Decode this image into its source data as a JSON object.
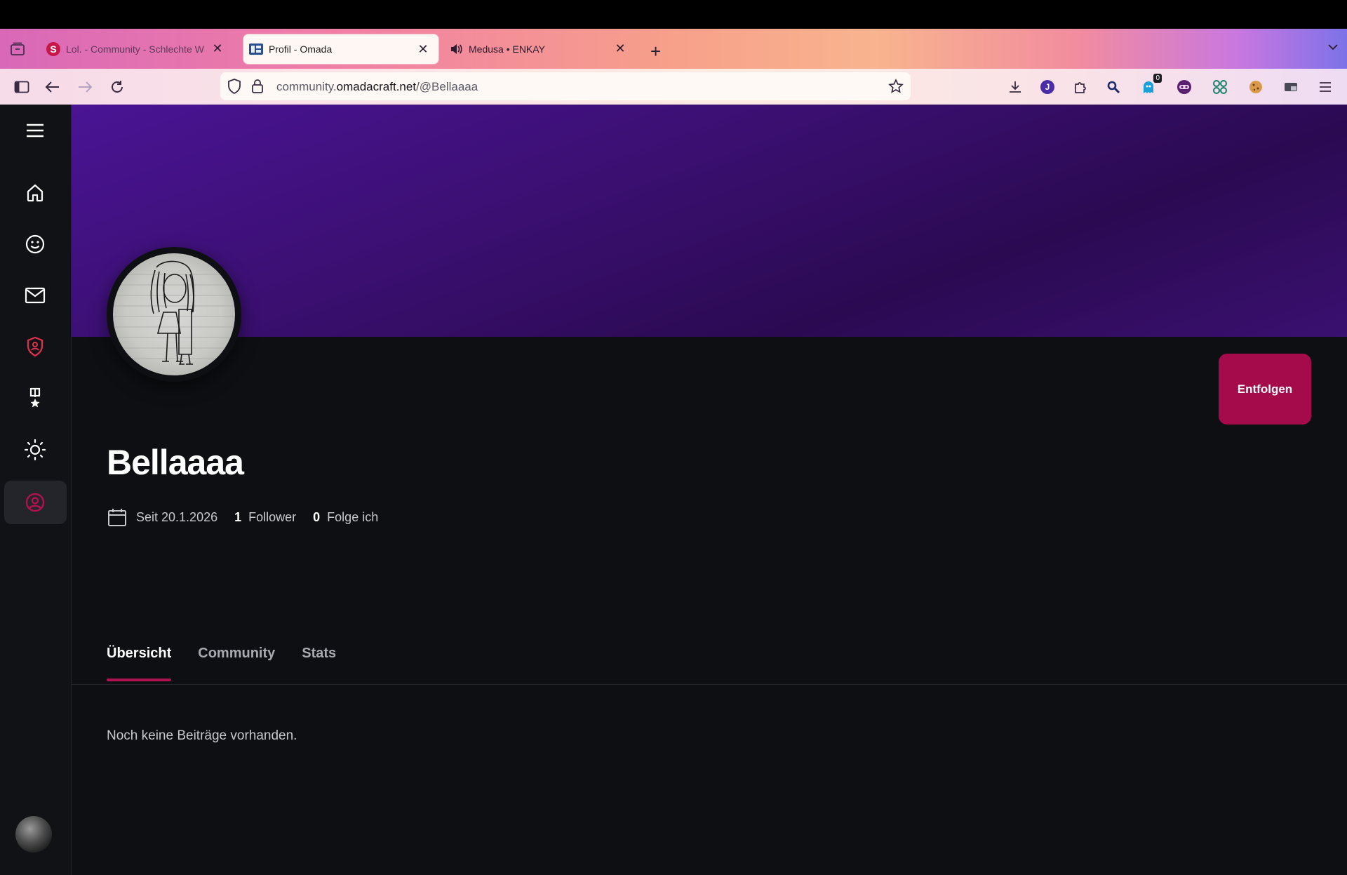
{
  "browser": {
    "tabs": [
      {
        "title": "Lol. - Community - Schlechte W",
        "favicon": "s-logo-icon",
        "active": false
      },
      {
        "title": "Profil - Omada",
        "favicon": "omada-logo-icon",
        "active": true
      },
      {
        "title": "Medusa • ENKAY",
        "favicon": "speaker-icon",
        "active": false
      }
    ],
    "url": {
      "prefix": "community.",
      "host": "omadacraft.net",
      "path": "/@Bellaaaa"
    },
    "extensions": [
      {
        "icon": "download-icon"
      },
      {
        "icon": "extension-j-icon",
        "label": "J"
      },
      {
        "icon": "puzzle-icon"
      },
      {
        "icon": "magnifier-extension-icon"
      },
      {
        "icon": "ghostery-icon",
        "badge": "0"
      },
      {
        "icon": "mask-extension-icon"
      },
      {
        "icon": "grid-extension-icon"
      },
      {
        "icon": "cookie-icon"
      },
      {
        "icon": "pip-extension-icon"
      },
      {
        "icon": "menu-icon"
      }
    ],
    "colors": {
      "tab_active_bg": "#fff7f3",
      "toolbar_bg": "#fbe4e6"
    }
  },
  "sidebar": {
    "items": [
      {
        "icon": "menu-icon"
      },
      {
        "icon": "home-icon"
      },
      {
        "icon": "smiley-icon"
      },
      {
        "icon": "mail-icon"
      },
      {
        "icon": "shield-user-icon",
        "color": "#e0314f"
      },
      {
        "icon": "award-icon"
      },
      {
        "icon": "sun-icon"
      },
      {
        "icon": "profile-icon",
        "active": true,
        "color": "#b0114f"
      }
    ]
  },
  "profile": {
    "username": "Bellaaaa",
    "since": "Seit 20.1.2026",
    "followers_count": "1",
    "followers_label": "Follower",
    "following_count": "0",
    "following_label": "Folge ich",
    "follow_button": "Entfolgen",
    "accent": "#a50a4a",
    "banner_color": "#3a0f70"
  },
  "tabs": [
    {
      "label": "Übersicht",
      "active": true
    },
    {
      "label": "Community",
      "active": false
    },
    {
      "label": "Stats",
      "active": false
    }
  ],
  "content": {
    "empty_message": "Noch keine Beiträge vorhanden."
  }
}
